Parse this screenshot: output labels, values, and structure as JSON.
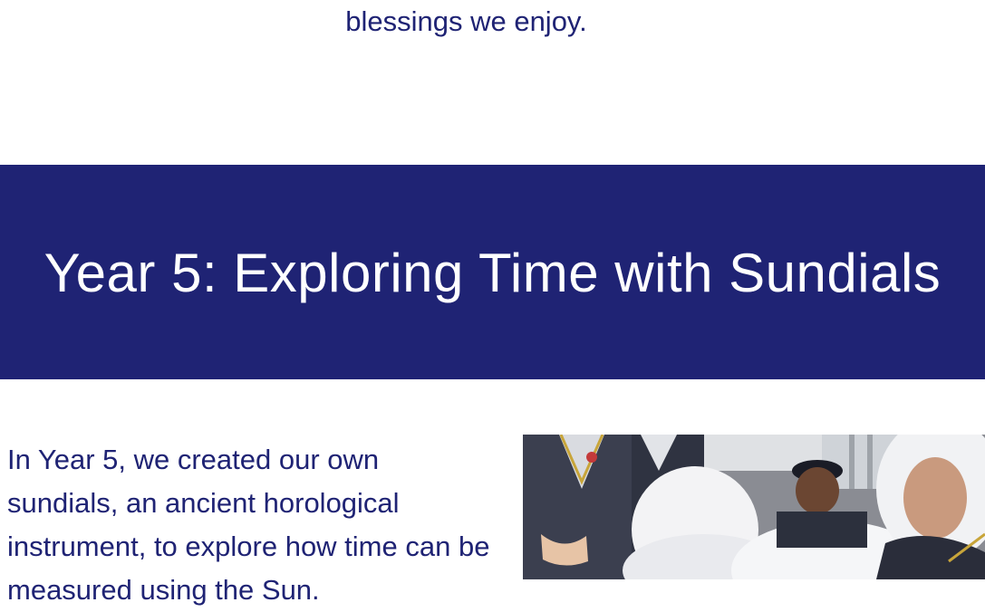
{
  "intro": {
    "text_tail": "blessings we enjoy."
  },
  "section": {
    "title": "Year 5: Exploring Time with Sundials",
    "paragraph": "In Year 5, we created our own sundials, an ancient horological instrument, to explore how time can be measured using the Sun.",
    "photo_icon": "photo-students-sundial"
  },
  "colors": {
    "brand_navy": "#1f2374",
    "white": "#ffffff"
  }
}
